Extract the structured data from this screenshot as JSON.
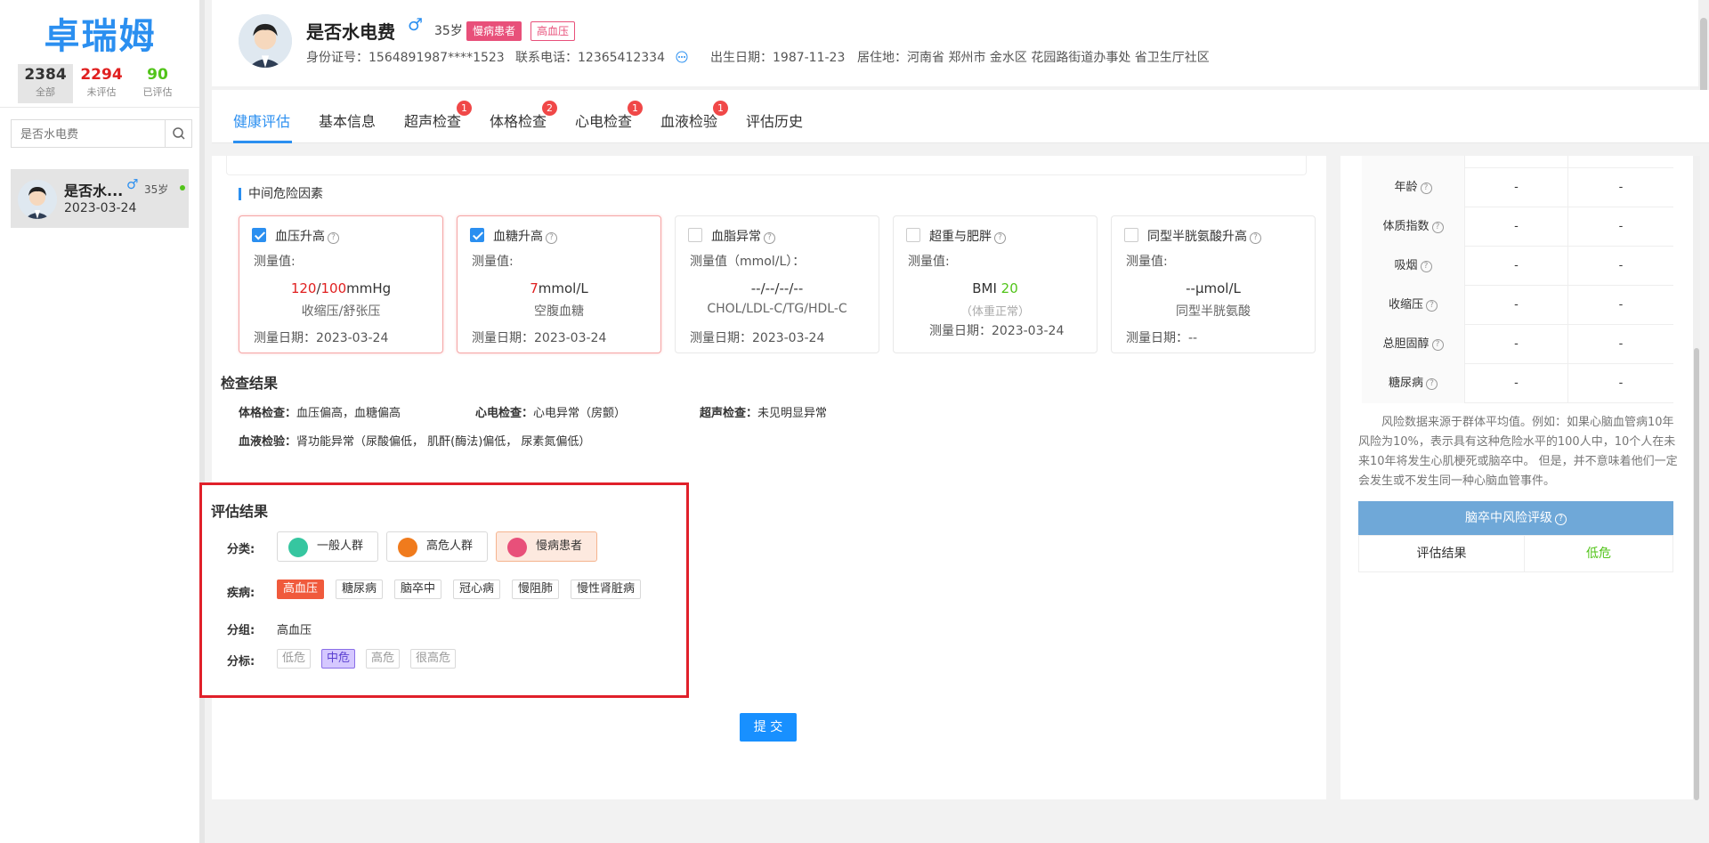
{
  "app": {
    "logo": "卓瑞姆"
  },
  "stats": [
    {
      "value": "2384",
      "label": "全部"
    },
    {
      "value": "2294",
      "label": "未评估"
    },
    {
      "value": "90",
      "label": "已评估"
    }
  ],
  "sidebar": {
    "search_placeholder": "是否水电费",
    "patient": {
      "name": "是否水...",
      "sex": "♂",
      "age": "35岁",
      "date": "2023-03-24"
    }
  },
  "header": {
    "name": "是否水电费",
    "sex": "♂",
    "age": "35岁",
    "tags": [
      "慢病患者",
      "高血压"
    ],
    "id_label": "身份证号：",
    "id_value": "1564891987****1523",
    "phone_label": "联系电话：",
    "phone_value": "12365412334",
    "birth_label": "出生日期：",
    "birth_value": "1987-11-23",
    "addr_label": "居住地：",
    "addr_value": "河南省 郑州市 金水区 花园路街道办事处 省卫生厅社区"
  },
  "tabs": [
    {
      "label": "健康评估",
      "badge": ""
    },
    {
      "label": "基本信息",
      "badge": ""
    },
    {
      "label": "超声检查",
      "badge": "1"
    },
    {
      "label": "体格检查",
      "badge": "2"
    },
    {
      "label": "心电检查",
      "badge": "1"
    },
    {
      "label": "血液检验",
      "badge": "1"
    },
    {
      "label": "评估历史",
      "badge": ""
    }
  ],
  "risk": {
    "section_title": "中间危险因素",
    "cards": [
      {
        "title": "血压升高",
        "checked": true,
        "measure_label": "测量值:",
        "value_a": "120",
        "value_sep": "/",
        "value_b": "100",
        "value_unit": "mmHg",
        "sub": "收缩压/舒张压",
        "date": "测量日期：2023-03-24"
      },
      {
        "title": "血糖升高",
        "checked": true,
        "measure_label": "测量值:",
        "value_a": "7",
        "value_unit": "mmol/L",
        "sub": "空腹血糖",
        "date": "测量日期：2023-03-24"
      },
      {
        "title": "血脂异常",
        "checked": false,
        "measure_label": "测量值（mmol/L）：",
        "value": "--/--/--/--",
        "sub": "CHOL/LDL-C/TG/HDL-C",
        "date": "测量日期：2023-03-24"
      },
      {
        "title": "超重与肥胖",
        "checked": false,
        "measure_label": "测量值:",
        "value_a": "BMI ",
        "value_b": "20",
        "sub": "（体重正常）",
        "date": "测量日期：2023-03-24"
      },
      {
        "title": "同型半胱氨酸升高",
        "checked": false,
        "measure_label": "测量值:",
        "value": "--μmol/L",
        "sub": "同型半胱氨酸",
        "date": "测量日期：--"
      }
    ]
  },
  "exam": {
    "title": "检查结果",
    "items": [
      {
        "label": "体格检查：",
        "value": "血压偏高，血糖偏高"
      },
      {
        "label": "心电检查：",
        "value": "心电异常（房颤）"
      },
      {
        "label": "超声检查：",
        "value": "未见明显异常"
      },
      {
        "label": "血液检验：",
        "value": "肾功能异常（尿酸偏低， 肌酐(酶法)偏低， 尿素氮偏低）"
      }
    ]
  },
  "eval": {
    "title": "评估结果",
    "class_label": "分类:",
    "classes": [
      "一般人群",
      "高危人群",
      "慢病患者"
    ],
    "disease_label": "疾病:",
    "diseases": [
      "高血压",
      "糖尿病",
      "脑卒中",
      "冠心病",
      "慢阻肺",
      "慢性肾脏病"
    ],
    "group_label": "分组:",
    "group_value": "高血压",
    "level_label": "分标:",
    "levels": [
      "低危",
      "中危",
      "高危",
      "很高危"
    ],
    "submit": "提 交"
  },
  "right": {
    "rows": [
      {
        "factor": "年龄",
        "a": "-",
        "b": "-"
      },
      {
        "factor": "体质指数",
        "a": "-",
        "b": "-"
      },
      {
        "factor": "吸烟",
        "a": "-",
        "b": "-"
      },
      {
        "factor": "收缩压",
        "a": "-",
        "b": "-"
      },
      {
        "factor": "总胆固醇",
        "a": "-",
        "b": "-"
      },
      {
        "factor": "糖尿病",
        "a": "-",
        "b": "-"
      }
    ],
    "note": "风险数据来源于群体平均值。例如：如果心脑血管病10年 风险为10%，表示具有这种危险水平的100人中，10个人在未来10年将发生心肌梗死或脑卒中。 但是，并不意味着他们一定会发生或不发生同一种心脑血管事件。",
    "stroke_header": "脑卒中风险评级",
    "stroke_key": "评估结果",
    "stroke_value": "低危"
  },
  "colors": {
    "accent": "#2b8ff0",
    "danger": "#e02020",
    "success": "#52c41a",
    "highlight_box": "#e0202a"
  }
}
